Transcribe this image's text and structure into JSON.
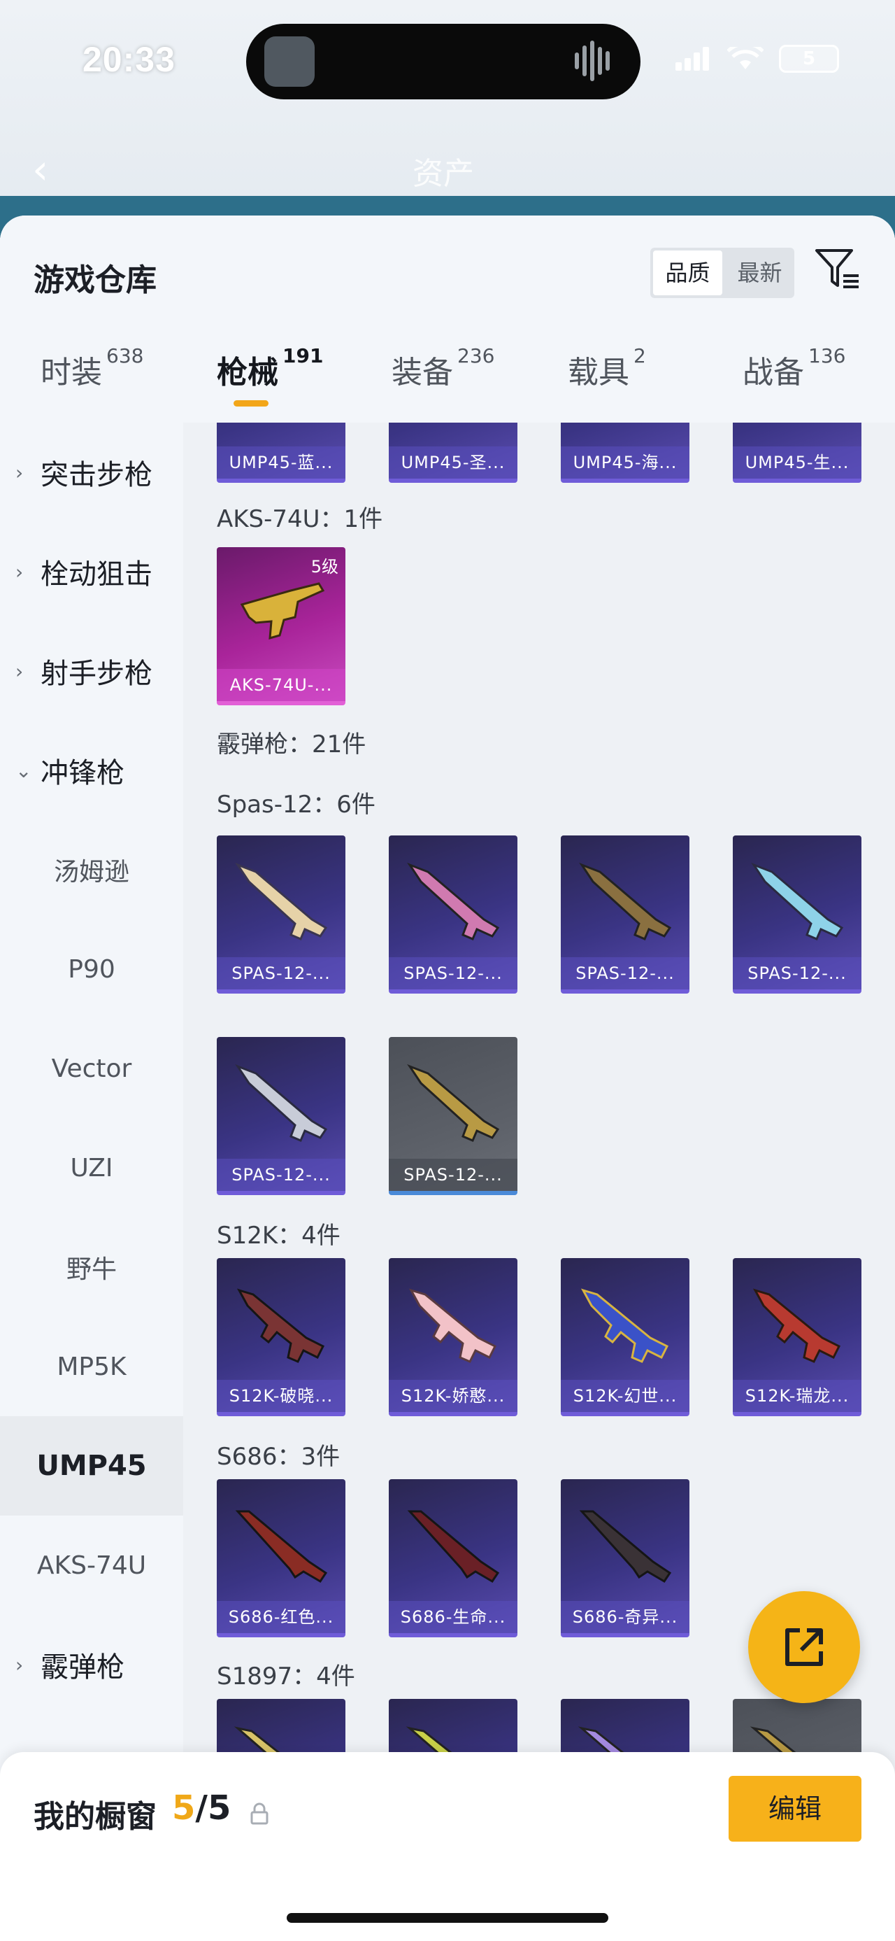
{
  "status": {
    "time": "20:33",
    "battery": "5"
  },
  "bg_app": {
    "back": "‹",
    "title": "资产"
  },
  "header": {
    "title": "游戏仓库",
    "sort": {
      "options": [
        "品质",
        "最新"
      ],
      "selected": "品质"
    },
    "filter_icon": "filter-icon"
  },
  "tabs": [
    {
      "label": "时装",
      "count": "638"
    },
    {
      "label": "枪械",
      "count": "191"
    },
    {
      "label": "装备",
      "count": "236"
    },
    {
      "label": "载具",
      "count": "2"
    },
    {
      "label": "战备",
      "count": "136"
    }
  ],
  "active_tab": "枪械",
  "sidebar": {
    "items": [
      {
        "label": "突击步枪",
        "kind": "category",
        "expanded": false
      },
      {
        "label": "栓动狙击",
        "kind": "category",
        "expanded": false
      },
      {
        "label": "射手步枪",
        "kind": "category",
        "expanded": false
      },
      {
        "label": "冲锋枪",
        "kind": "category",
        "expanded": true
      },
      {
        "label": "汤姆逊",
        "kind": "sub"
      },
      {
        "label": "P90",
        "kind": "sub"
      },
      {
        "label": "Vector",
        "kind": "sub"
      },
      {
        "label": "UZI",
        "kind": "sub"
      },
      {
        "label": "野牛",
        "kind": "sub"
      },
      {
        "label": "MP5K",
        "kind": "sub"
      },
      {
        "label": "UMP45",
        "kind": "sub",
        "selected": true
      },
      {
        "label": "AKS-74U",
        "kind": "sub"
      },
      {
        "label": "霰弹枪",
        "kind": "category",
        "expanded": false
      }
    ]
  },
  "content": {
    "top_partial_cards": [
      "UMP45-蓝...",
      "UMP45-圣...",
      "UMP45-海...",
      "UMP45-生..."
    ],
    "aks_label": "AKS-74U：1件",
    "aks_cards": [
      {
        "name": "AKS-74U-...",
        "level": "5级"
      }
    ],
    "shotgun_label": "霰弹枪：21件",
    "spas_label": "Spas-12：6件",
    "spas_cards": [
      "SPAS-12-...",
      "SPAS-12-...",
      "SPAS-12-...",
      "SPAS-12-...",
      "SPAS-12-...",
      "SPAS-12-..."
    ],
    "s12k_label": "S12K：4件",
    "s12k_cards": [
      "S12K-破晓...",
      "S12K-娇憨...",
      "S12K-幻世...",
      "S12K-瑞龙..."
    ],
    "s686_label": "S686：3件",
    "s686_cards": [
      "S686-红色...",
      "S686-生命...",
      "S686-奇异..."
    ],
    "s1897_label": "S1897：4件"
  },
  "fab": {
    "icon": "share-external-icon"
  },
  "bottom": {
    "title": "我的橱窗",
    "count_current": "5",
    "count_sep": "/",
    "count_total": "5",
    "edit": "编辑"
  },
  "colors": {
    "accent": "#f5b417",
    "card_purple": "#3a3484",
    "card_pink": "#a9249a",
    "card_grey": "#5c6068"
  }
}
